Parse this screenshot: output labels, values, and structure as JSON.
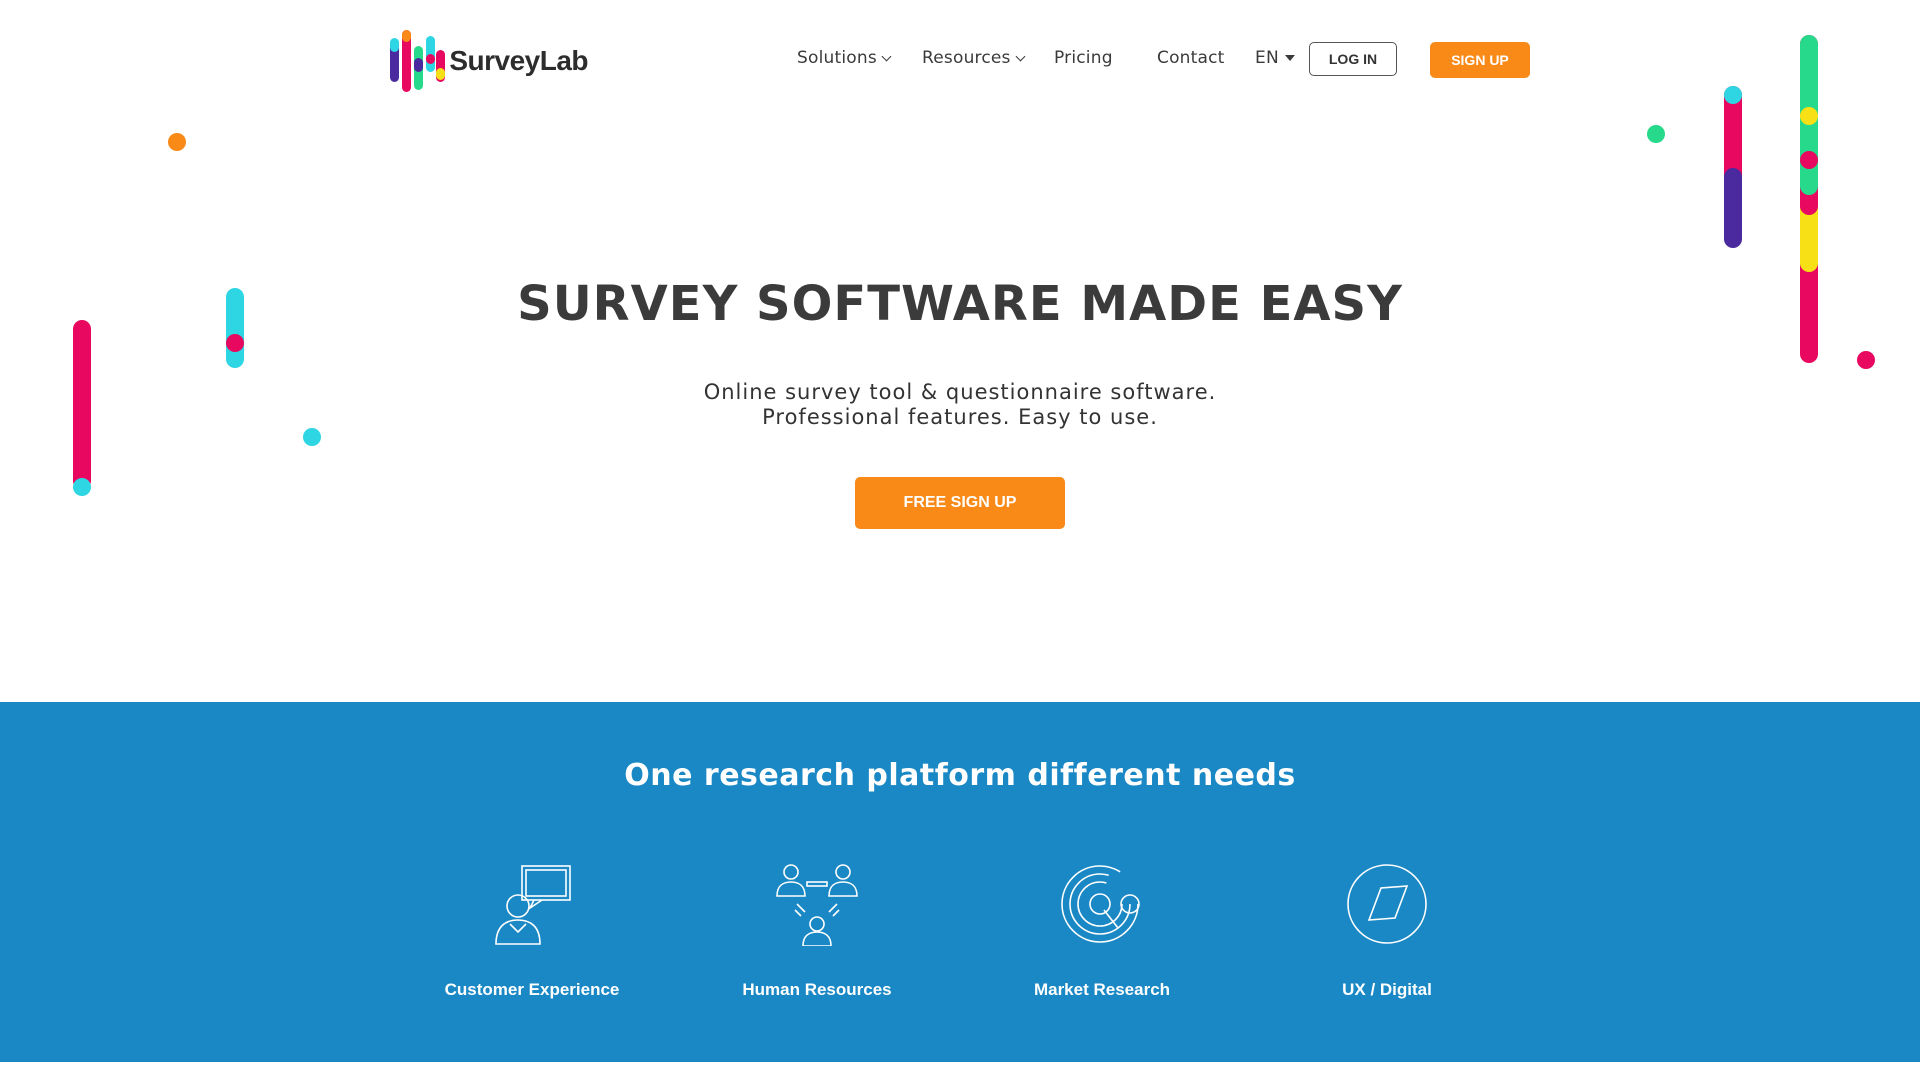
{
  "brand": {
    "name": "SurveyLab"
  },
  "nav": {
    "solutions": "Solutions",
    "resources": "Resources",
    "pricing": "Pricing",
    "contact": "Contact",
    "language": "EN",
    "login": "LOG IN",
    "signup": "SIGN UP"
  },
  "hero": {
    "title": "SURVEY SOFTWARE MADE EASY",
    "subtitle_line1": "Online survey tool & questionnaire software.",
    "subtitle_line2": "Professional features. Easy to use.",
    "cta": "FREE SIGN UP"
  },
  "platform": {
    "title": "One research platform different needs",
    "items": [
      {
        "label": "Customer Experience",
        "icon": "customer-experience-icon"
      },
      {
        "label": "Human Resources",
        "icon": "human-resources-icon"
      },
      {
        "label": "Market Research",
        "icon": "market-research-icon"
      },
      {
        "label": "UX / Digital",
        "icon": "ux-digital-icon"
      }
    ]
  },
  "colors": {
    "accent": "#f98a17",
    "section_blue": "#1a88c4",
    "pink": "#e8085f",
    "cyan": "#2dd6e2",
    "green": "#27d98a",
    "yellow": "#f7e016",
    "purple": "#4a2a9e"
  }
}
